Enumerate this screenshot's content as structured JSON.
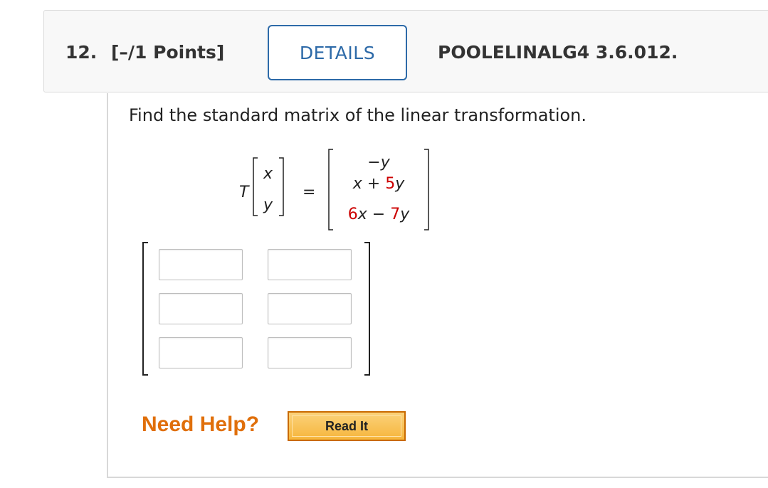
{
  "header": {
    "question_number": "12.",
    "points": "[–/1 Points]",
    "details_label": "DETAILS",
    "problem_code": "POOLELINALG4 3.6.012."
  },
  "question": {
    "prompt": "Find the standard matrix of the linear transformation.",
    "equation": {
      "function_name": "T",
      "input_vector": [
        "x",
        "y"
      ],
      "equals": "=",
      "output_rows": [
        {
          "parts": [
            {
              "text": "−",
              "color": "#222222"
            },
            {
              "text": "y",
              "color": "#222222",
              "italic": true
            }
          ]
        },
        {
          "parts": [
            {
              "text": "x",
              "color": "#222222",
              "italic": true
            },
            {
              "text": " + ",
              "color": "#222222"
            },
            {
              "text": "5",
              "color": "#cc0000"
            },
            {
              "text": "y",
              "color": "#222222",
              "italic": true
            }
          ]
        },
        {
          "parts": [
            {
              "text": "6",
              "color": "#cc0000"
            },
            {
              "text": "x",
              "color": "#222222",
              "italic": true
            },
            {
              "text": " − ",
              "color": "#222222"
            },
            {
              "text": "7",
              "color": "#cc0000"
            },
            {
              "text": "y",
              "color": "#222222",
              "italic": true
            }
          ]
        }
      ]
    },
    "answer_matrix": {
      "rows": 3,
      "cols": 2,
      "values": [
        [
          "",
          ""
        ],
        [
          "",
          ""
        ],
        [
          "",
          ""
        ]
      ]
    }
  },
  "help": {
    "need_help_label": "Need Help?",
    "read_it_label": "Read It"
  },
  "colors": {
    "accent_blue": "#2d6aa8",
    "help_orange": "#e06f0a",
    "coefficient_red": "#cc0000"
  }
}
